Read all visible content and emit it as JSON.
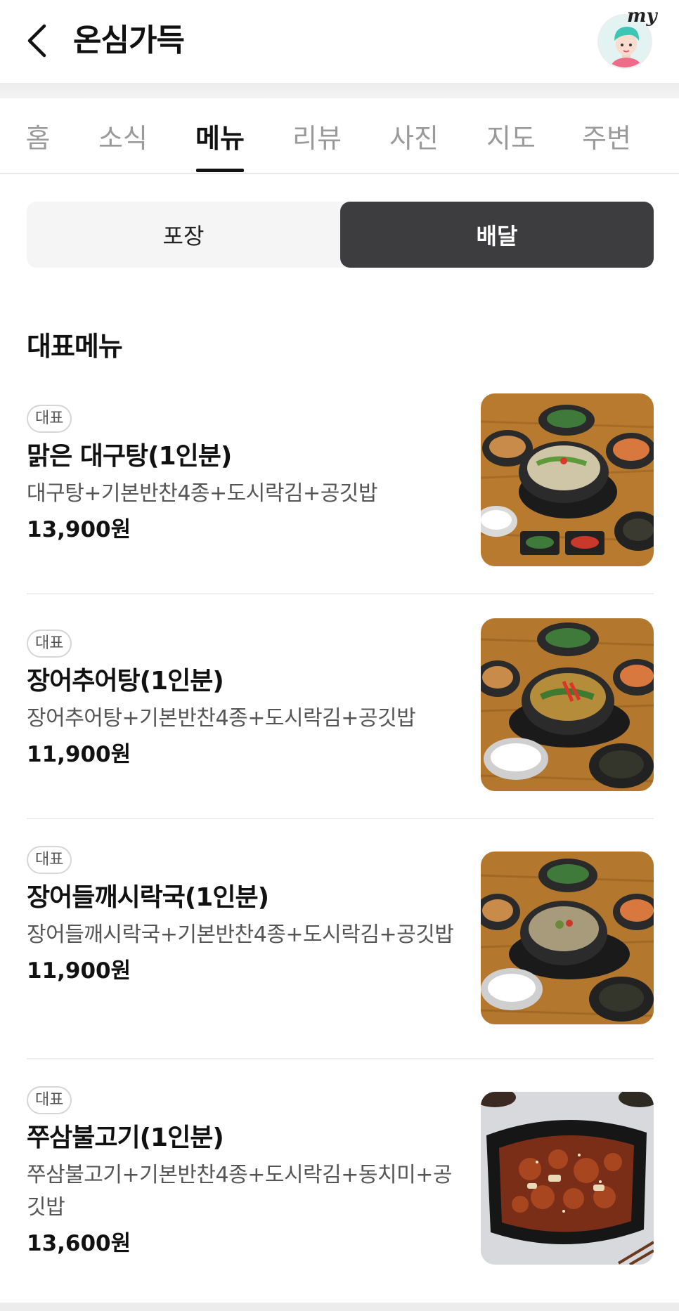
{
  "header": {
    "title": "온심가득",
    "avatar_label": "my"
  },
  "tabs": [
    {
      "label": "홈",
      "active": false
    },
    {
      "label": "소식",
      "active": false
    },
    {
      "label": "메뉴",
      "active": true
    },
    {
      "label": "리뷰",
      "active": false
    },
    {
      "label": "사진",
      "active": false
    },
    {
      "label": "지도",
      "active": false
    },
    {
      "label": "주변",
      "active": false
    }
  ],
  "segment": {
    "left_label": "포장",
    "right_label": "배달",
    "selected": "배달"
  },
  "section_title": "대표메뉴",
  "menu_items": [
    {
      "badge": "대표",
      "name": "맑은 대구탕(1인분)",
      "description": "대구탕+기본반찬4종+도시락김+공깃밥",
      "price": "13,900원",
      "image": "clear-cod-soup-photo"
    },
    {
      "badge": "대표",
      "name": "장어추어탕(1인분)",
      "description": "장어추어탕+기본반찬4종+도시락김+공깃밥",
      "price": "11,900원",
      "image": "eel-loach-soup-photo"
    },
    {
      "badge": "대표",
      "name": "장어들깨시락국(1인분)",
      "description": "장어들깨시락국+기본반찬4종+도시락김+공깃밥",
      "price": "11,900원",
      "image": "eel-perilla-soup-photo"
    },
    {
      "badge": "대표",
      "name": "쭈삼불고기(1인분)",
      "description": "쭈삼불고기+기본반찬4종+도시락김+동치미+공깃밥",
      "price": "13,600원",
      "image": "spicy-pork-webfoot-octopus-photo"
    }
  ],
  "colors": {
    "segment_active_bg": "#3d3d3f",
    "segment_bg": "#f5f5f6",
    "tab_inactive": "#9a9a9a",
    "wood": "#b77a2e"
  }
}
